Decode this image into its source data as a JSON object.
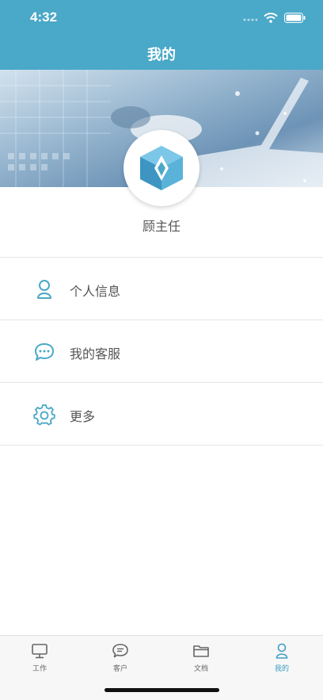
{
  "status_bar": {
    "time": "4:32"
  },
  "nav": {
    "title": "我的"
  },
  "profile": {
    "name": "顾主任"
  },
  "menu": [
    {
      "label": "个人信息",
      "icon": "person-icon"
    },
    {
      "label": "我的客服",
      "icon": "chat-icon"
    },
    {
      "label": "更多",
      "icon": "gear-icon"
    }
  ],
  "tabs": [
    {
      "label": "工作",
      "icon": "monitor-icon"
    },
    {
      "label": "客户",
      "icon": "chat-bubble-icon"
    },
    {
      "label": "文档",
      "icon": "folder-icon"
    },
    {
      "label": "我的",
      "icon": "person-icon",
      "active": true
    }
  ],
  "colors": {
    "header": "#4aa8c8",
    "accent": "#3f9ec2"
  }
}
